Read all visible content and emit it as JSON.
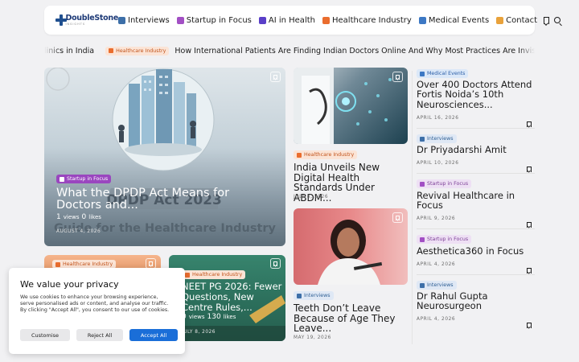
{
  "header": {
    "logo_main": "DoubleStone",
    "logo_sub": "INSIGHTS",
    "nav": [
      {
        "label": "Interviews",
        "icon": "interviews-icon",
        "color": "#3d6fa8"
      },
      {
        "label": "Startup in Focus",
        "icon": "startup-icon",
        "color": "#a24fc4"
      },
      {
        "label": "AI in Health",
        "icon": "ai-icon",
        "color": "#5a3fc8"
      },
      {
        "label": "Healthcare Industry",
        "icon": "healthcare-icon",
        "color": "#ea6d2e"
      },
      {
        "label": "Medical Events",
        "icon": "medical-events-icon",
        "color": "#3c78c4"
      },
      {
        "label": "Contact",
        "icon": "contact-icon",
        "color": "#e9a23b"
      }
    ],
    "accent_color": "#f0743d"
  },
  "ticker": {
    "prev_text": "linics in India",
    "badge": "Healthcare Industry",
    "headline": "How International Patients Are Finding Indian Doctors Online And Why Most Practices Are Invisible to Them"
  },
  "hero": {
    "badge": "Startup in Focus",
    "title": "What the DPDP Act Means for Doctors and...",
    "views_count": "1",
    "views_label": "views",
    "likes_count": "0",
    "likes_label": "likes",
    "date": "AUGUST 4, 2026",
    "image_caption_1": "DPDP Act 2023",
    "image_caption_2": "Guide for the Healthcare Industry"
  },
  "bottom_left": {
    "badge": "Healthcare Industry"
  },
  "bottom_mid": {
    "badge": "Healthcare Industry",
    "title": "NEET PG 2026: Fewer Questions, New Centre Rules,...",
    "views_count": "0",
    "views_label": "views",
    "likes_count": "130",
    "likes_label": "likes",
    "date": "JULY 8, 2026"
  },
  "middle": [
    {
      "badge": "Healthcare Industry",
      "title": "India Unveils New Digital Health Standards Under ABDM...",
      "date": "JULY 8, 2026"
    },
    {
      "badge": "Interviews",
      "title": "Teeth Don’t Leave Because of Age They Leave...",
      "date": "MAY 19, 2026"
    }
  ],
  "right": [
    {
      "badge": "Medical Events",
      "title": "Over 400 Doctors Attend Fortis Noida’s 10th Neurosciences...",
      "date": "APRIL 16, 2026"
    },
    {
      "badge": "Interviews",
      "title": "Dr Priyadarshi Amit",
      "date": "APRIL 10, 2026"
    },
    {
      "badge": "Startup in Focus",
      "title": "Revival Healthcare in Focus",
      "date": "APRIL 9, 2026"
    },
    {
      "badge": "Startup in Focus",
      "title": "Aesthetica360 in Focus",
      "date": "APRIL 4, 2026"
    },
    {
      "badge": "Interviews",
      "title": "Dr Rahul Gupta Neurosurgeon",
      "date": "APRIL 4, 2026"
    }
  ],
  "cookie": {
    "title": "We value your privacy",
    "text": "We use cookies to enhance your browsing experience, serve personalised ads or content, and analyse our traffic. By clicking \"Accept All\", you consent to our use of cookies.",
    "customise": "Customise",
    "reject": "Reject All",
    "accept": "Accept All"
  }
}
